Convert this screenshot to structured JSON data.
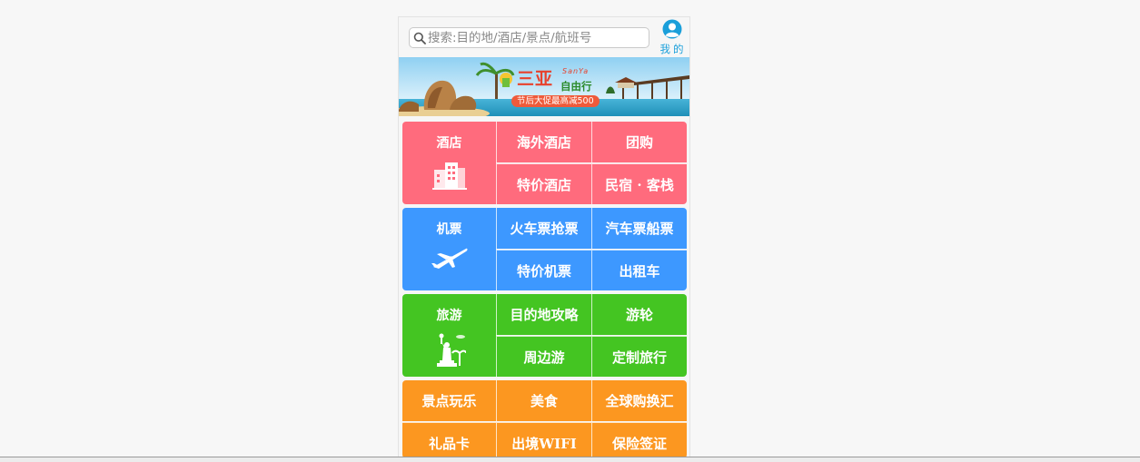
{
  "search": {
    "placeholder": "搜索:目的地/酒店/景点/航班号",
    "icon": "search-icon"
  },
  "me": {
    "label": "我的",
    "icon": "user-avatar-icon",
    "color": "#1a9fda"
  },
  "banner": {
    "title": "三亚",
    "title_en": "SanYa",
    "subtitle": "自由行",
    "promo": "节后大促最高减500"
  },
  "colors": {
    "hotel": "#ff6b7d",
    "flight": "#3d98ff",
    "travel": "#44c522",
    "other": "#fc9720"
  },
  "sections": {
    "hotel": {
      "main": "酒店",
      "main_icon": "hotel-building-icon",
      "items": [
        "海外酒店",
        "团购",
        "特价酒店",
        "民宿 · 客栈"
      ]
    },
    "flight": {
      "main": "机票",
      "main_icon": "airplane-icon",
      "items": [
        "火车票抢票",
        "汽车票船票",
        "特价机票",
        "出租车"
      ]
    },
    "travel": {
      "main": "旅游",
      "main_icon": "statue-of-liberty-icon",
      "items": [
        "目的地攻略",
        "游轮",
        "周边游",
        "定制旅行"
      ]
    },
    "other": {
      "items": [
        "景点玩乐",
        "美食",
        "全球购换汇",
        "礼品卡",
        "出境WIFI",
        "保险签证"
      ]
    }
  }
}
